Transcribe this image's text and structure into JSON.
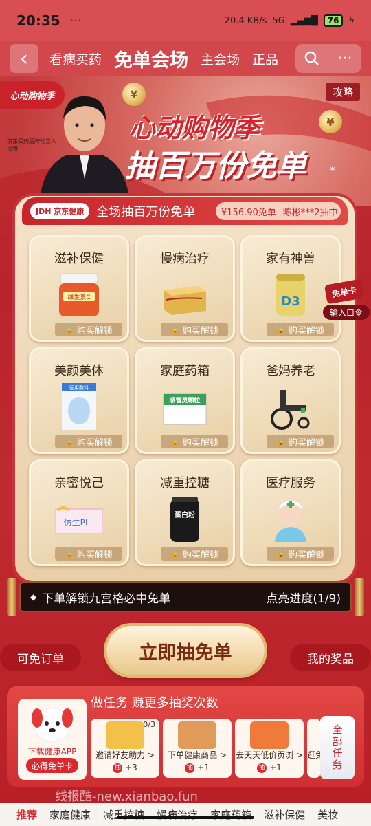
{
  "status_bar": {
    "time": "20:35",
    "dots": "···",
    "net_speed": "20.4 KB/s",
    "signal": "5G",
    "battery": "76"
  },
  "nav": {
    "tabs": [
      "看病买药",
      "免单会场",
      "主会场",
      "正品"
    ],
    "active_tab": "免单会场"
  },
  "hero": {
    "ribbon": "心动购物季",
    "brand_line": "京东买药品牌代言人",
    "spokesperson": "沈腾",
    "headline1": "心动购物季",
    "headline2": "抽百万份免单",
    "star": "*",
    "strategy": "攻略"
  },
  "board": {
    "logo": "JDH 京东健康",
    "title": "全场抽百万份免单",
    "ticker_amount": "¥156.90免单",
    "ticker_user": "陈彬***2抽中"
  },
  "cells": [
    {
      "title": "滋补保健",
      "unlock": "购买解锁",
      "img_label": "维生素C",
      "img_color": "#e85a2a"
    },
    {
      "title": "慢病治疗",
      "unlock": "购买解锁",
      "img_label": "",
      "img_color": "#e2b54a"
    },
    {
      "title": "家有神兽",
      "unlock": "购买解锁",
      "img_label": "D3",
      "img_color": "#e8d36a"
    },
    {
      "title": "美颜美体",
      "unlock": "购买解锁",
      "img_label": "医用敷料",
      "img_color": "#3a7ad8"
    },
    {
      "title": "家庭药箱",
      "unlock": "购买解锁",
      "img_label": "感冒灵颗粒",
      "img_color": "#3aa05a"
    },
    {
      "title": "爸妈养老",
      "unlock": "购买解锁",
      "img_label": "",
      "img_color": "#2a2a2a"
    },
    {
      "title": "亲密悦己",
      "unlock": "购买解锁",
      "img_label": "仿生PI",
      "img_color": "#f0a0c0"
    },
    {
      "title": "减重控糖",
      "unlock": "购买解锁",
      "img_label": "蛋白粉",
      "img_color": "#1a1a1a"
    },
    {
      "title": "医疗服务",
      "unlock": "购买解锁",
      "img_label": "",
      "img_color": "#7ac8e8"
    }
  ],
  "side": {
    "card": "免单卡",
    "code": "输入口令"
  },
  "progress": {
    "text": "下单解锁九宫格必中免单",
    "status": "点亮进度(1/9)"
  },
  "actions": {
    "left": "可免订单",
    "draw": "立即抽免单",
    "right": "我的奖品"
  },
  "tasks": {
    "title": "做任务 赚更多抽奖次数",
    "mascot_label": "下载健康APP",
    "mascot_button": "必得免单卡",
    "items": [
      {
        "label": "邀请好友助力 >",
        "reward": "+3",
        "count": "0/3",
        "color": "#f3c14a"
      },
      {
        "label": "下单健康商品 >",
        "reward": "+1",
        "count": "",
        "color": "#e09a5a"
      },
      {
        "label": "去天天低价页浏 >",
        "reward": "+1",
        "count": "",
        "color": "#f07a3a"
      },
      {
        "label": "逛免",
        "reward": "",
        "count": "",
        "color": "#f3a03a"
      }
    ],
    "all": "全部任务"
  },
  "watermark": "线报酷-new.xianbao.fun",
  "bottom_tabs": [
    "推荐",
    "家庭健康",
    "减重控糖",
    "慢病治疗",
    "家庭药箱",
    "滋补保健",
    "美妆"
  ]
}
